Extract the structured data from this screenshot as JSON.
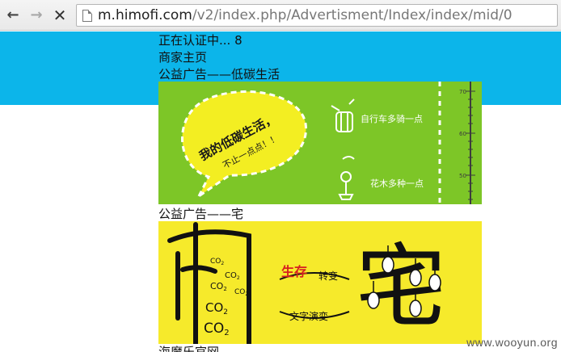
{
  "browser": {
    "back_icon": "back-arrow-icon",
    "forward_icon": "forward-arrow-icon",
    "stop_icon": "stop-x-icon",
    "url_host": "m.himofi.com",
    "url_path": "/v2/index.php/Advertisment/Index/index/mid/0"
  },
  "page": {
    "header_color": "#0cb5ea",
    "status_text": "正在认证中... 8",
    "home_link": "商家主页",
    "ad1_title": "公益广告——低碳生活",
    "ad1_image": {
      "bubble_line1": "我的低碳生活，",
      "bubble_line2": "不止一点点！！",
      "caption1": "自行车多骑一点",
      "caption2": "花木多种一点",
      "ruler_labels": [
        "70",
        "60",
        "50"
      ]
    },
    "ad2_title": "公益广告——宅",
    "ad2_image": {
      "co2": "CO",
      "co2_sub": "2",
      "word_red": "生存",
      "word1": "转变",
      "word2": "文字演变",
      "big_char": "宅"
    },
    "next_title": "海魔乐官网"
  },
  "watermark": "www.wooyun.org"
}
